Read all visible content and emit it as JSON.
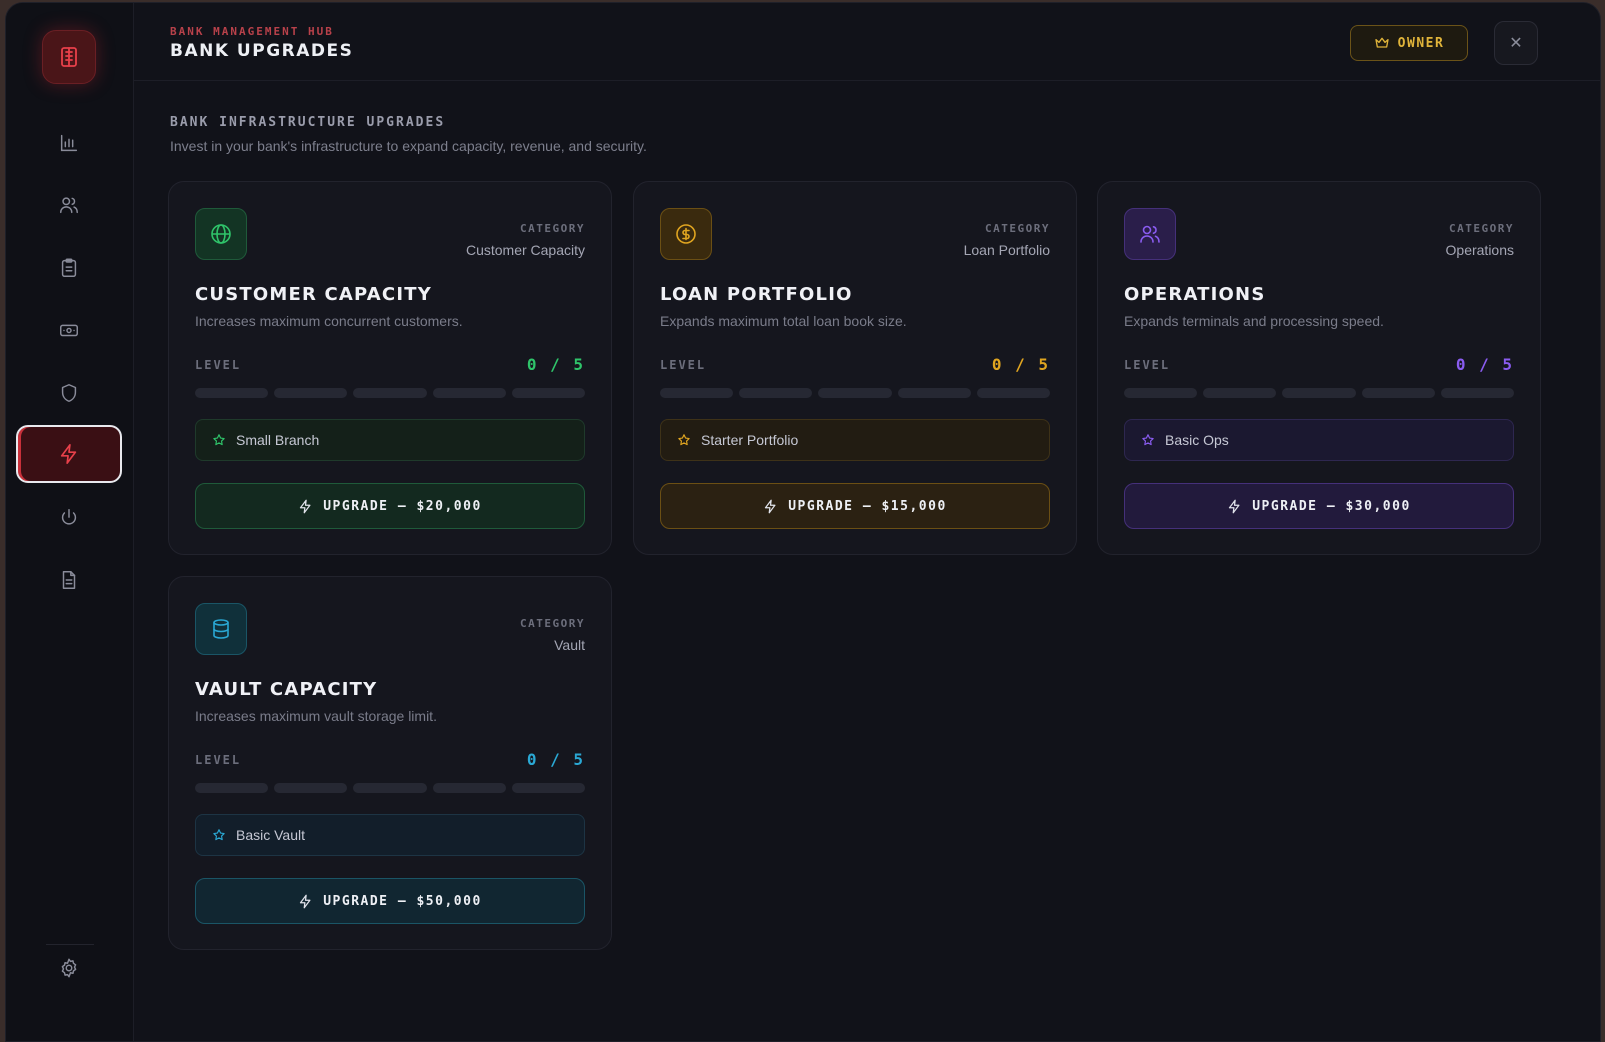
{
  "header": {
    "hub_label": "BANK MANAGEMENT HUB",
    "title": "BANK UPGRADES",
    "owner_label": "OWNER",
    "close_glyph": "✕"
  },
  "sidebar": {
    "items": [
      {
        "icon": "bank-icon"
      },
      {
        "icon": "bar-chart-icon"
      },
      {
        "icon": "users-icon"
      },
      {
        "icon": "clipboard-icon"
      },
      {
        "icon": "cash-icon"
      },
      {
        "icon": "shield-icon"
      },
      {
        "icon": "lightning-icon",
        "active": true
      },
      {
        "icon": "power-icon"
      },
      {
        "icon": "document-icon"
      },
      {
        "icon": "gear-icon"
      }
    ]
  },
  "section": {
    "title": "BANK INFRASTRUCTURE UPGRADES",
    "description": "Invest in your bank's infrastructure to expand capacity, revenue, and security."
  },
  "cards": [
    {
      "icon": "globe-icon",
      "category_label": "CATEGORY",
      "category": "Customer Capacity",
      "title": "CUSTOMER CAPACITY",
      "description": "Increases maximum concurrent customers.",
      "level_label": "LEVEL",
      "level": 0,
      "max_level": 5,
      "level_text": "0 / 5",
      "tier": "Small Branch",
      "upgrade_label": "UPGRADE — $20,000",
      "accent": "#2fc46a"
    },
    {
      "icon": "dollar-coin-icon",
      "category_label": "CATEGORY",
      "category": "Loan Portfolio",
      "title": "LOAN PORTFOLIO",
      "description": "Expands maximum total loan book size.",
      "level_label": "LEVEL",
      "level": 0,
      "max_level": 5,
      "level_text": "0 / 5",
      "tier": "Starter Portfolio",
      "upgrade_label": "UPGRADE — $15,000",
      "accent": "#e0a520"
    },
    {
      "icon": "users-icon",
      "category_label": "CATEGORY",
      "category": "Operations",
      "title": "OPERATIONS",
      "description": "Expands terminals and processing speed.",
      "level_label": "LEVEL",
      "level": 0,
      "max_level": 5,
      "level_text": "0 / 5",
      "tier": "Basic Ops",
      "upgrade_label": "UPGRADE — $30,000",
      "accent": "#8a5cf0"
    },
    {
      "icon": "database-icon",
      "category_label": "CATEGORY",
      "category": "Vault",
      "title": "VAULT CAPACITY",
      "description": "Increases maximum vault storage limit.",
      "level_label": "LEVEL",
      "level": 0,
      "max_level": 5,
      "level_text": "0 / 5",
      "tier": "Basic Vault",
      "upgrade_label": "UPGRADE — $50,000",
      "accent": "#2aa8d4"
    }
  ]
}
